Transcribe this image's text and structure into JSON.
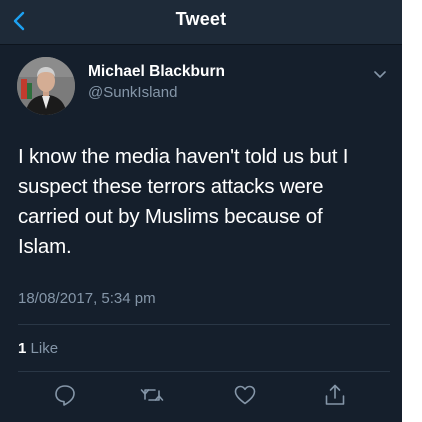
{
  "navbar": {
    "title": "Tweet",
    "back_icon": "chevron-left-icon"
  },
  "tweet": {
    "author_name": "Michael Blackburn",
    "author_handle": "@SunkIsland",
    "text_lines": [
      "I know the media haven't told us but I",
      "suspect these terrors attacks were",
      "carried out by Muslims because of",
      "Islam."
    ],
    "timestamp": "18/08/2017, 5:34 pm",
    "likes_count": "1",
    "likes_label": "Like"
  },
  "actions": [
    {
      "icon": "reply-icon"
    },
    {
      "icon": "retweet-icon"
    },
    {
      "icon": "heart-icon"
    },
    {
      "icon": "share-icon"
    }
  ],
  "colors": {
    "background": "#151f2c",
    "navbar": "#1e2a38",
    "accent": "#1da1f2",
    "secondary_text": "#8596a8",
    "divider": "#2a3746"
  }
}
